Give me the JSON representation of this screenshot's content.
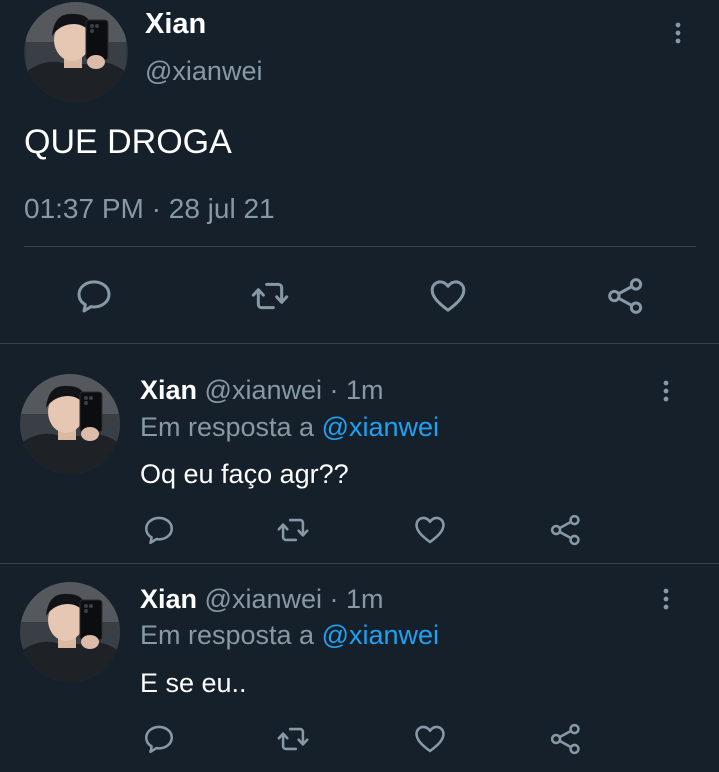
{
  "main_tweet": {
    "author_name": "Xian",
    "handle": "@xianwei",
    "text": "QUE DROGA",
    "time": "01:37 PM",
    "separator": "·",
    "date": "28 jul 21"
  },
  "replies": [
    {
      "author_name": "Xian",
      "handle": "@xianwei",
      "time_sep": "·",
      "time": "1m",
      "reply_prefix": "Em resposta a",
      "reply_to": "@xianwei",
      "text": "Oq eu faço agr??"
    },
    {
      "author_name": "Xian",
      "handle": "@xianwei",
      "time_sep": "·",
      "time": "1m",
      "reply_prefix": "Em resposta a",
      "reply_to": "@xianwei",
      "text": "E se eu.."
    }
  ],
  "icons": {
    "more": "more-vertical-icon",
    "reply": "reply-icon",
    "retweet": "retweet-icon",
    "like": "heart-icon",
    "share": "share-icon"
  },
  "colors": {
    "background": "#15202b",
    "divider": "#38444d",
    "muted_text": "#8899a6",
    "link": "#1da1f2",
    "icon": "#8899a6"
  }
}
